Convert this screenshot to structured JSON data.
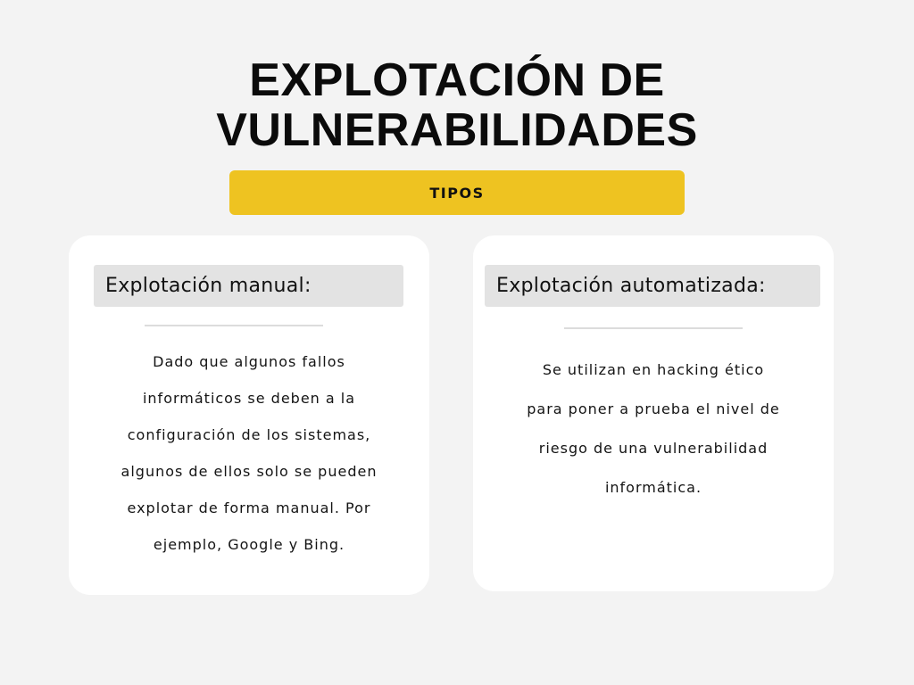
{
  "title": {
    "line1": "EXPLOTACIÓN DE",
    "line2": "VULNERABILIDADES"
  },
  "banner": {
    "label": "TIPOS",
    "color": "#eec321"
  },
  "cards": [
    {
      "heading": "Explotación manual:",
      "body_lines": [
        "Dado que algunos fallos",
        "informáticos se deben a la",
        "configuración de los sistemas,",
        "algunos de ellos solo se pueden",
        "explotar de forma manual. Por",
        "ejemplo, Google y Bing."
      ]
    },
    {
      "heading": "Explotación automatizada:",
      "body_lines": [
        "Se utilizan en hacking ético",
        "para poner a prueba el nivel de",
        "riesgo de una vulnerabilidad",
        "informática."
      ]
    }
  ]
}
